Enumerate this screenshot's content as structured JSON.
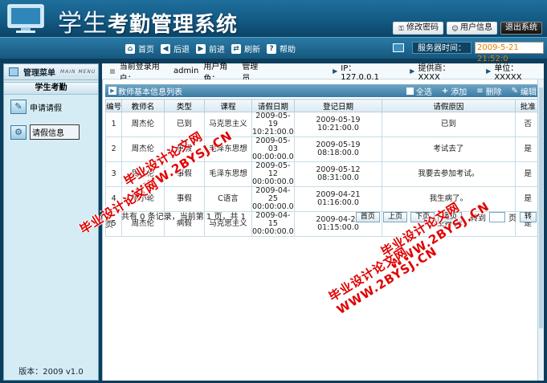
{
  "header": {
    "title_part1": "学生",
    "title_part2": "考勤管理系统",
    "buttons": [
      {
        "label": "修改密码",
        "icon": "key-icon"
      },
      {
        "label": "用户信息",
        "icon": "user-icon"
      },
      {
        "label": "退出系统",
        "icon": "exit-icon"
      }
    ]
  },
  "nav": {
    "items": [
      {
        "label": "首页",
        "icon": "home-icon",
        "glyph": "⌂"
      },
      {
        "label": "后退",
        "icon": "back-icon",
        "glyph": "◀"
      },
      {
        "label": "前进",
        "icon": "forward-icon",
        "glyph": "▶"
      },
      {
        "label": "刷新",
        "icon": "refresh-icon",
        "glyph": "⇄"
      },
      {
        "label": "帮助",
        "icon": "help-icon",
        "glyph": "?"
      }
    ],
    "server_label": "服务器时间：",
    "server_time": "2009-5-21 21:52:0"
  },
  "sidebar": {
    "title": "管理菜单",
    "title_en": "MAIN MENU",
    "group": "学生考勤",
    "items": [
      {
        "label": "申请请假",
        "icon": "leave-request-icon"
      },
      {
        "label": "请假信息",
        "icon": "leave-info-icon"
      }
    ],
    "version": "版本：2009 v1.0"
  },
  "infobar": {
    "user_label": "当前登录用户：",
    "user": "admin",
    "role_label": "用户角色：",
    "role": "管理员",
    "ip": "IP：127.0.0.1",
    "provider": "提供商：XXXX",
    "unit": "单位：XXXXX"
  },
  "panel": {
    "title": "教师基本信息列表",
    "tools": {
      "select_all": "全选",
      "add": "添加",
      "delete": "删除",
      "edit": "编辑"
    }
  },
  "table": {
    "headers": [
      "编号",
      "教师名",
      "类型",
      "课程",
      "请假日期",
      "登记日期",
      "请假原因",
      "批准"
    ],
    "rows": [
      {
        "id": "1",
        "teacher": "周杰伦",
        "type": "已到",
        "course": "马克思主义",
        "leave_date_1": "2009-05-19",
        "leave_date_2": "10:21:00.0",
        "reg_date": "2009-05-19 10:21:00.0",
        "reason": "已到",
        "approved": "否"
      },
      {
        "id": "2",
        "teacher": "周杰伦",
        "type": "事假",
        "course": "毛泽东思想",
        "leave_date_1": "2009-05-03",
        "leave_date_2": "00:00:00.0",
        "reg_date": "2009-05-19 08:18:00.0",
        "reason": "考试去了",
        "approved": "是"
      },
      {
        "id": "3",
        "teacher": "周杰伦",
        "type": "事假",
        "course": "毛泽东思想",
        "leave_date_1": "2009-05-12",
        "leave_date_2": "00:00:00.0",
        "reg_date": "2009-05-12 08:31:00.0",
        "reason": "我要去参加考试。",
        "approved": "是"
      },
      {
        "id": "4",
        "teacher": "周小轮",
        "type": "事假",
        "course": "C语言",
        "leave_date_1": "2009-04-25",
        "leave_date_2": "00:00:00.0",
        "reg_date": "2009-04-21 01:16:00.0",
        "reason": "我生病了。",
        "approved": "是"
      },
      {
        "id": "5",
        "teacher": "周杰伦",
        "type": "病假",
        "course": "马克思主义",
        "leave_date_1": "2009-04-15",
        "leave_date_2": "00:00:00.0",
        "reg_date": "2009-04-21 01:15:00.0",
        "reason": "我生病了。",
        "approved": "是"
      }
    ]
  },
  "pager": {
    "summary_line1": "共有 0 条记录，当前第 1 页，共 1",
    "summary_line2": "页",
    "first": "首页",
    "prev": "上页",
    "next": "下页",
    "last": "尾页",
    "goto_label": "转到",
    "page_suffix": "页",
    "go": "转"
  },
  "watermark": {
    "line_cn": "毕业设计论文网",
    "line_en": "WWW.2BYSJ.CN"
  }
}
